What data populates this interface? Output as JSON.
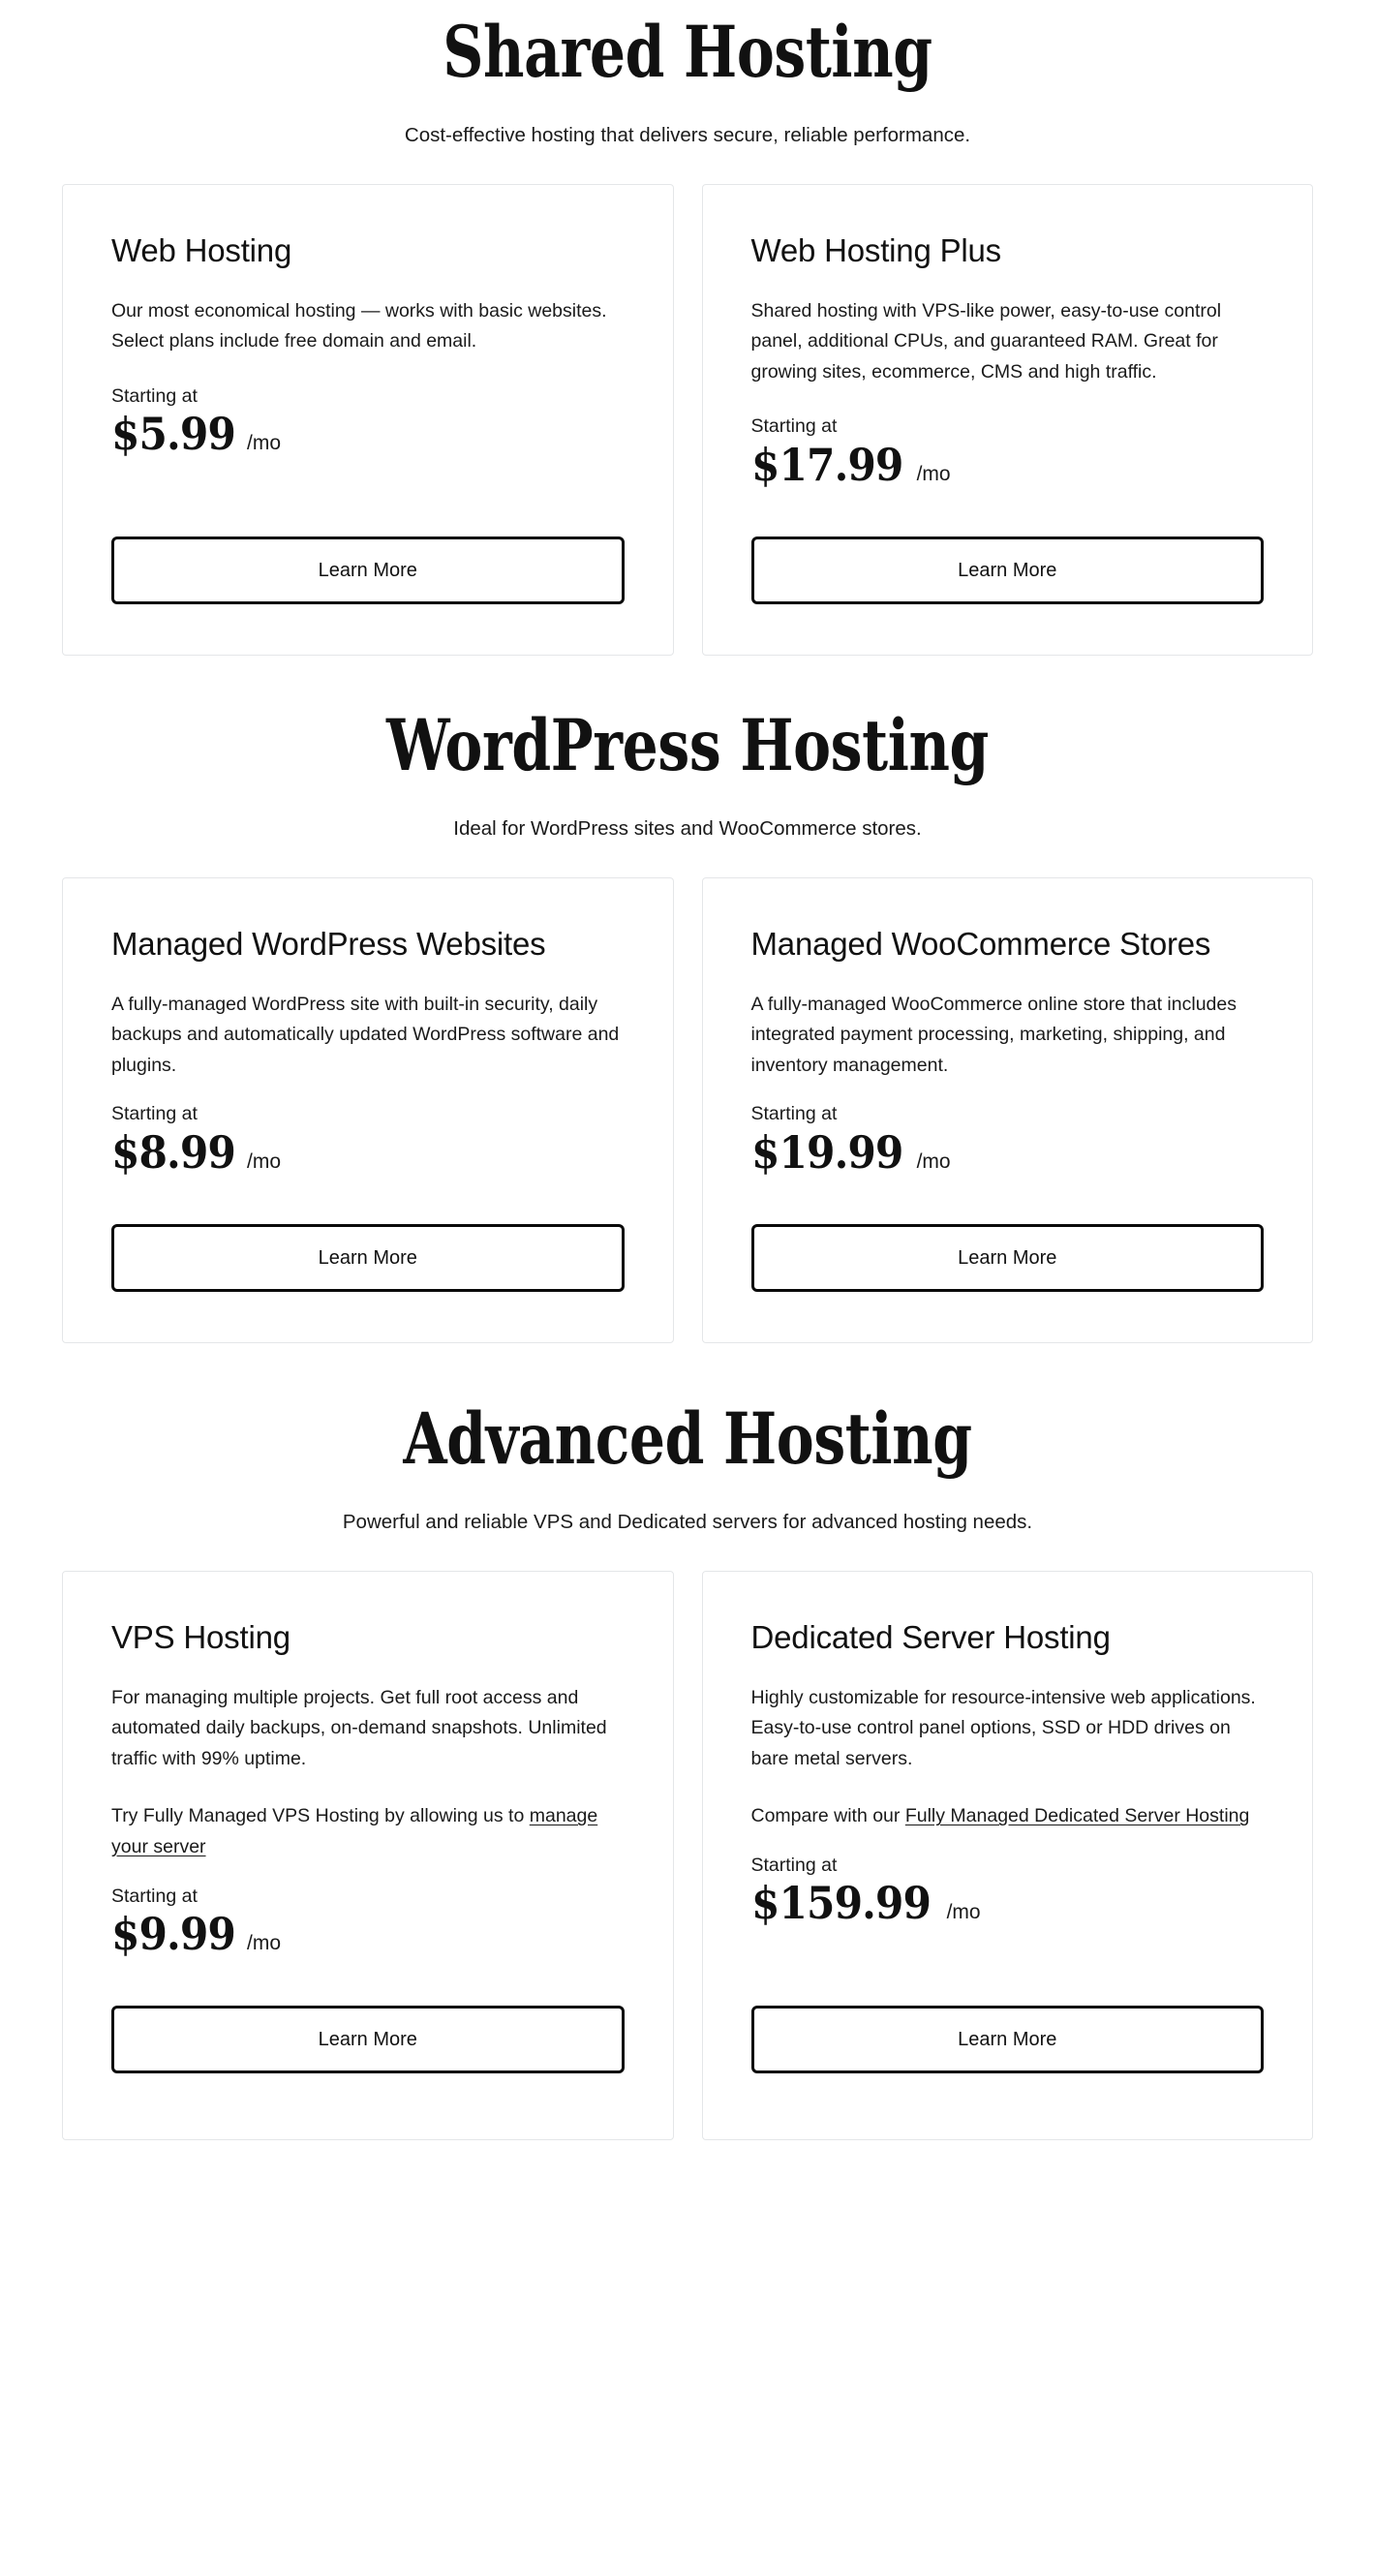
{
  "sections": [
    {
      "id": "shared-hosting",
      "title": "Shared Hosting",
      "subtitle": "Cost-effective hosting that delivers secure, reliable performance.",
      "cards": [
        {
          "title": "Web Hosting",
          "description": "Our most economical hosting — works with basic websites. Select plans include free domain and email.",
          "starting_label": "Starting at",
          "price": "$5.99",
          "period": "/mo",
          "button": "Learn More"
        },
        {
          "title": "Web Hosting Plus",
          "description": "Shared hosting with VPS-like power, easy-to-use control panel, additional CPUs, and guaranteed RAM. Great for growing sites, ecommerce, CMS and high traffic.",
          "starting_label": "Starting at",
          "price": "$17.99",
          "period": "/mo",
          "button": "Learn More"
        }
      ]
    },
    {
      "id": "wordpress-hosting",
      "title": "WordPress Hosting",
      "subtitle": "Ideal for WordPress sites and WooCommerce stores.",
      "cards": [
        {
          "title": "Managed WordPress Websites",
          "description": "A fully-managed WordPress site with built-in security, daily backups and automatically updated WordPress software and plugins.",
          "starting_label": "Starting at",
          "price": "$8.99",
          "period": "/mo",
          "button": "Learn More"
        },
        {
          "title": "Managed WooCommerce Stores",
          "description": "A fully-managed WooCommerce online store that includes integrated payment processing, marketing, shipping, and inventory management.",
          "starting_label": "Starting at",
          "price": "$19.99",
          "period": "/mo",
          "button": "Learn More"
        }
      ]
    },
    {
      "id": "advanced-hosting",
      "title": "Advanced Hosting",
      "subtitle": "Powerful and reliable VPS and Dedicated servers for advanced hosting needs.",
      "cards": [
        {
          "title": "VPS Hosting",
          "description": "For managing multiple projects. Get full root access and automated daily backups, on-demand snapshots. Unlimited traffic with 99% uptime.",
          "note_prefix": "Try Fully Managed VPS Hosting by allowing us to ",
          "note_link": "manage your server",
          "note_suffix": "",
          "starting_label": "Starting at",
          "price": "$9.99",
          "period": "/mo",
          "button": "Learn More"
        },
        {
          "title": "Dedicated Server Hosting",
          "description": "Highly customizable for resource-intensive web applications. Easy-to-use control panel options, SSD or HDD drives on bare metal servers.",
          "note_prefix": "Compare with our ",
          "note_link": "Fully Managed Dedicated Server Hosting",
          "note_suffix": "",
          "starting_label": "Starting at",
          "price": "$159.99",
          "period": "/mo",
          "button": "Learn More"
        }
      ]
    }
  ],
  "colors": {
    "text": "#111111",
    "card_border": "#e4e6e8",
    "button_border": "#0a0a0a",
    "background": "#ffffff"
  }
}
